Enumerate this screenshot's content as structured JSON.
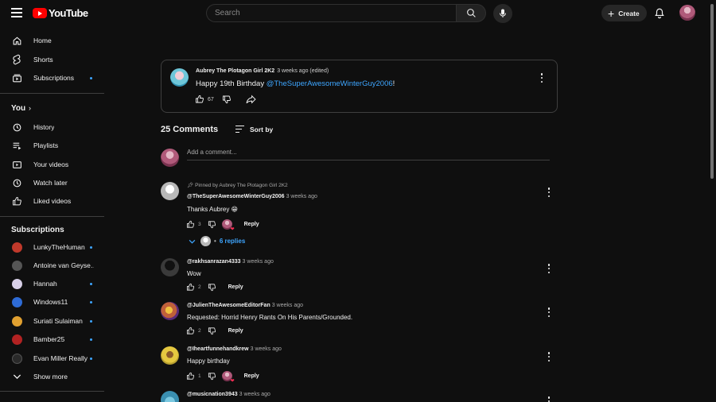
{
  "header": {
    "logo_text": "YouTube",
    "search_placeholder": "Search",
    "create_label": "Create"
  },
  "sidebar": {
    "main": [
      {
        "label": "Home",
        "icon": "home-icon"
      },
      {
        "label": "Shorts",
        "icon": "shorts-icon"
      },
      {
        "label": "Subscriptions",
        "icon": "subscriptions-icon"
      }
    ],
    "you_title": "You",
    "you_items": [
      {
        "label": "History",
        "icon": "history-icon"
      },
      {
        "label": "Playlists",
        "icon": "playlists-icon"
      },
      {
        "label": "Your videos",
        "icon": "your-videos-icon"
      },
      {
        "label": "Watch later",
        "icon": "watch-later-icon"
      },
      {
        "label": "Liked videos",
        "icon": "liked-videos-icon"
      }
    ],
    "subscriptions_title": "Subscriptions",
    "subscriptions": [
      {
        "label": "LunkyTheHuman",
        "color": "#c0392b"
      },
      {
        "label": "Antoine van Geyse…",
        "color": "#555555"
      },
      {
        "label": "Hannah",
        "color": "#d8d0e8"
      },
      {
        "label": "Windows11",
        "color": "#2e6bd6"
      },
      {
        "label": "Suriati Sulaiman",
        "color": "#e0a030"
      },
      {
        "label": "Bamber25",
        "color": "#b22222"
      },
      {
        "label": "Evan Miller Really",
        "color": "#2a2a2a"
      }
    ],
    "show_more": "Show more"
  },
  "post": {
    "author": "Aubrey The Plotagon Girl 2K2",
    "time": "3 weeks ago (edited)",
    "text_prefix": "Happy 19th Birthday ",
    "mention": "@TheSuperAwesomeWinterGuy2006",
    "text_suffix": "!",
    "likes": "67"
  },
  "comments_section": {
    "count_label": "25 Comments",
    "sort_label": "Sort by",
    "add_placeholder": "Add a comment..."
  },
  "comments": [
    {
      "pinned": "Pinned by Aubrey The Plotagon Girl 2K2",
      "author": "@TheSuperAwesomeWinterGuy2006",
      "time": "3 weeks ago",
      "text": "Thanks Aubrey 😁",
      "likes": "3",
      "reply": "Reply",
      "replies": "6 replies",
      "avatar_color": "#c9c9c9"
    },
    {
      "author": "@rakhsanrazan4333",
      "time": "3 weeks ago",
      "text": "Wow",
      "likes": "2",
      "reply": "Reply",
      "avatar_color": "#2b2b2b"
    },
    {
      "author": "@JulienTheAwesomeEditorFan",
      "time": "3 weeks ago",
      "text": "Requested: Horrid Henry Rants On His Parents/Grounded.",
      "likes": "2",
      "reply": "Reply",
      "avatar_color": "#c0603a"
    },
    {
      "author": "@Iheartfunnehandkrew",
      "time": "3 weeks ago",
      "text": "Happy birthday",
      "likes": "1",
      "reply": "Reply",
      "avatar_color": "#e5c840"
    },
    {
      "author": "@musicnation3943",
      "time": "3 weeks ago",
      "avatar_color": "#3a8fb0"
    }
  ]
}
